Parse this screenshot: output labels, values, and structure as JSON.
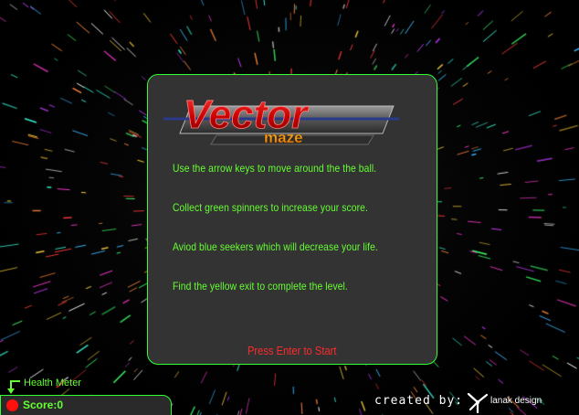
{
  "game": {
    "title_top": "Vector",
    "title_bottom": "maze"
  },
  "instructions": [
    "Use the arrow keys to move around the the ball.",
    "Collect green spinners to increase your score.",
    "Aviod blue seekers which will decrease your life.",
    "Find the yellow exit to complete the level."
  ],
  "prompt": {
    "start_label": "Press Enter to Start"
  },
  "hud": {
    "health_label": "Health Meter",
    "score_label": "Score:0"
  },
  "credit": {
    "prefix": "created by:",
    "name": "lanak design"
  },
  "colors": {
    "panel_border": "#33ff33",
    "instruction_text": "#66ff33",
    "start_text": "#ff2a2a",
    "logo_red": "#d40000",
    "logo_orange": "#ff9900",
    "health_dot": "#ff1010"
  }
}
